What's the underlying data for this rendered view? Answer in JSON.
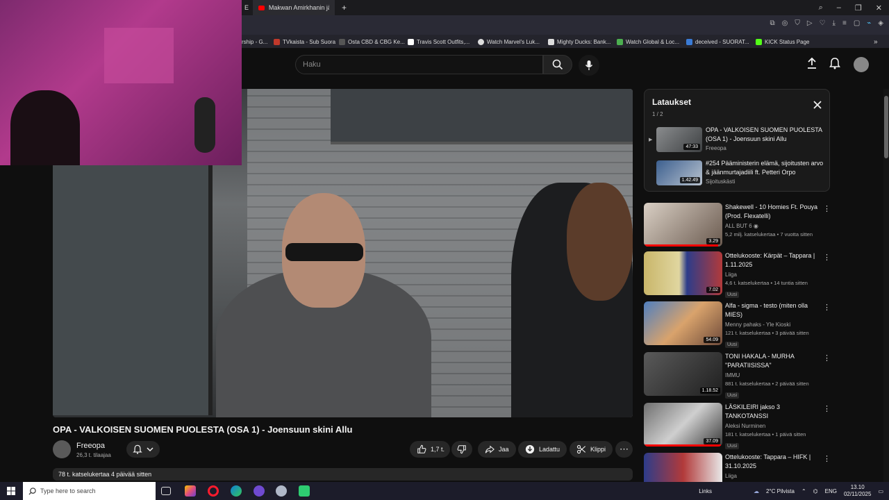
{
  "browser": {
    "tabs": [
      {
        "label": "E"
      },
      {
        "label": "Makwan Amirkhanin jälki"
      }
    ],
    "new_tab_label": "+"
  },
  "bookmarks": [
    {
      "label": "rship - G...",
      "color": "#777777"
    },
    {
      "label": "TVkaista - Sub Suora",
      "color": "#c0392b"
    },
    {
      "label": "Osta CBD & CBG Ke...",
      "color": "#555555"
    },
    {
      "label": "Travis Scott Outfits,...",
      "color": "#ffffff"
    },
    {
      "label": "Watch Marvel's Luk...",
      "color": "#dddddd"
    },
    {
      "label": "Mighty Ducks: Bank...",
      "color": "#dddddd"
    },
    {
      "label": "Watch Global & Loc...",
      "color": "#4caf50"
    },
    {
      "label": "deceived - SUORAT...",
      "color": "#3a7bd5"
    },
    {
      "label": "KICK Status Page",
      "color": "#53fc18"
    }
  ],
  "header": {
    "search_placeholder": "Haku"
  },
  "video": {
    "title": "OPA - VALKOISEN SUOMEN PUOLESTA (OSA 1) - Joensuun skini Allu",
    "channel": "Freeopa",
    "subscribers": "26,3 t. tilaajaa",
    "likes": "1,7 t.",
    "share_label": "Jaa",
    "download_label": "Ladattu",
    "clip_label": "Klippi",
    "more_label": "⋯",
    "description_meta": "78 t. katselukertaa  4 päivää sitten"
  },
  "playlist": {
    "title": "Lataukset",
    "count": "1 / 2",
    "items": [
      {
        "title": "OPA - VALKOISEN SUOMEN PUOLESTA (OSA 1) - Joensuun skini Allu",
        "channel": "Freeopa",
        "duration": "47:33",
        "indicator": "▶"
      },
      {
        "title": "#254 Pääministerin elämä, sijoitusten arvo & jäänmurtajadiili ft. Petteri Orpo",
        "channel": "Sijoituskästi",
        "duration": "1.42.49",
        "indicator": ""
      }
    ]
  },
  "recommendations": [
    {
      "title": "Shakewell - 10 Homies Ft. Pouya (Prod. Flexatelli)",
      "channel": "ALL BUT 6 ◉",
      "meta": "5,2 milj. katselukertaa • 7 vuotta sitten",
      "duration": "3.29",
      "badge": "",
      "progress": 0.95
    },
    {
      "title": "Ottelukooste: Kärpät – Tappara | 1.11.2025",
      "channel": "Liiga",
      "meta": "4,6 t. katselukertaa • 14 tuntia sitten",
      "duration": "7.02",
      "badge": "Uusi",
      "progress": 0
    },
    {
      "title": "Alfa - sigma - testo (miten olla MIES)",
      "channel": "Menny pahaks - Yle Kioski",
      "meta": "121 t. katselukertaa • 3 päivää sitten",
      "duration": "54.09",
      "badge": "Uusi",
      "progress": 0
    },
    {
      "title": "TONI HAKALA - MURHA \"PARATIISISSA\"",
      "channel": "IMMU",
      "meta": "881 t. katselukertaa • 2 päivää sitten",
      "duration": "1.18.52",
      "badge": "Uusi",
      "progress": 0
    },
    {
      "title": "LÄSKILEIRI jakso 3 TANKOTANSSI",
      "channel": "Aleksi Nurminen",
      "meta": "181 t. katselukertaa • 1 päivä sitten",
      "duration": "37.09",
      "badge": "Uusi",
      "progress": 0.98
    },
    {
      "title": "Ottelukooste: Tappara – HIFK | 31.10.2025",
      "channel": "Liiga",
      "meta": "",
      "duration": "",
      "badge": "",
      "progress": 0
    }
  ],
  "taskbar": {
    "search_placeholder": "Type here to search",
    "links_label": "Links",
    "weather": "2°C  Pilvista",
    "language": "ENG",
    "time": "13.10",
    "date": "02/11/2025"
  },
  "colors": {
    "accent": "#ff0000",
    "background": "#0f0f0f"
  }
}
